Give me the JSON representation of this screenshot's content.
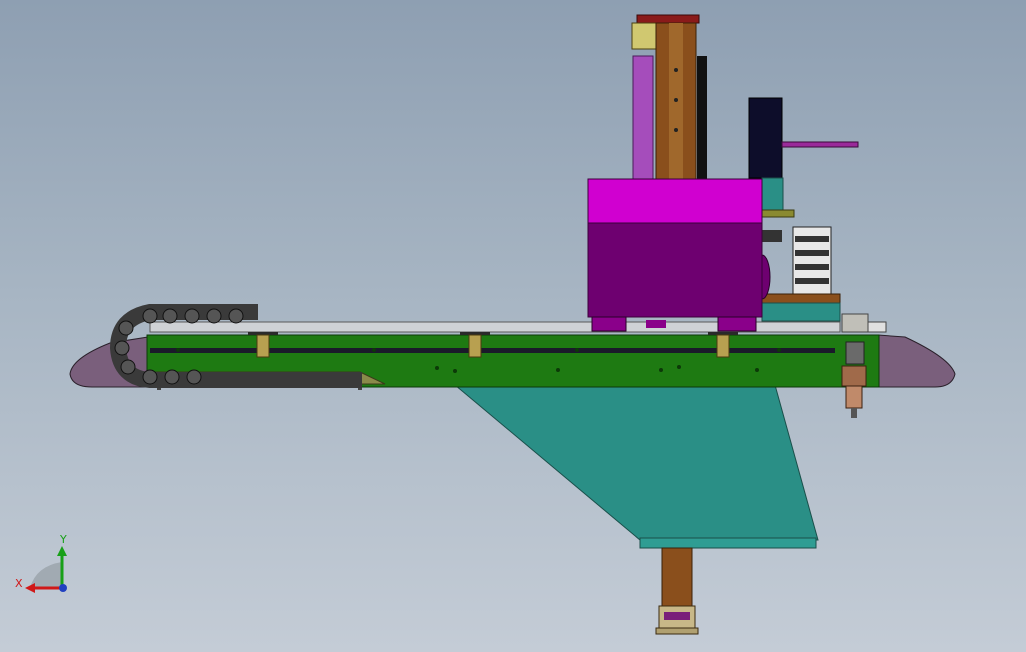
{
  "viewport": {
    "background_top": "#8e9fb2",
    "background_bottom": "#c4ccd6"
  },
  "model": {
    "colors": {
      "base_rail": "#1e7a12",
      "end_caps": "#7a5f7c",
      "carriage": "#6e0070",
      "carriage_top": "#d000d0",
      "column": "#8a4f1c",
      "bracket": "#2a8f86",
      "cable_chain": "#3a3a3a",
      "motor": "#0d0d2a",
      "purple_rod": "#a54dbb"
    }
  },
  "triad": {
    "x_label": "X",
    "y_label": "Y",
    "x_color": "#d01818",
    "y_color": "#18a018",
    "z_color": "#2040c0"
  }
}
